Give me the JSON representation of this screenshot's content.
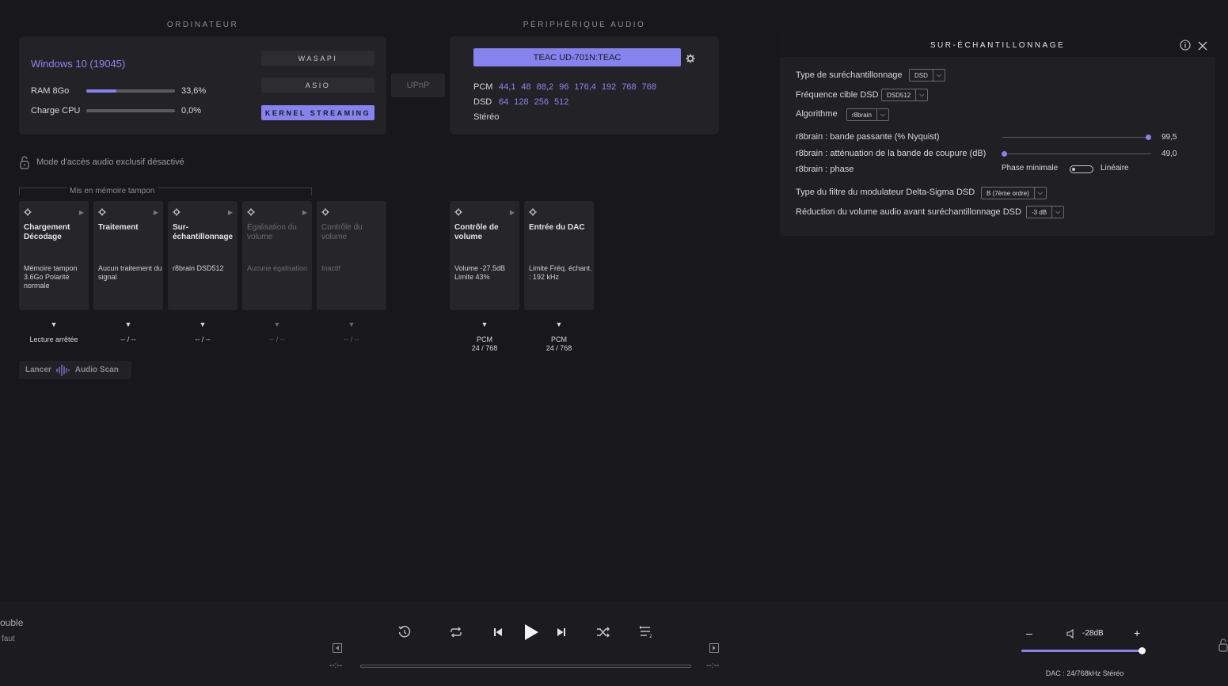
{
  "computer": {
    "heading": "ORDINATEUR",
    "os": "Windows 10 (19045)",
    "ram_label": "RAM 8Go",
    "ram_value": "33,6%",
    "ram_fraction": 0.336,
    "cpu_label": "Charge CPU",
    "cpu_value": "0,0%",
    "cpu_fraction": 0.0,
    "modes": [
      "WASAPI",
      "ASIO",
      "KERNEL STREAMING"
    ],
    "upnp": "UPnP",
    "exclusive_mode": "Mode d'accès audio exclusif désactivé"
  },
  "device": {
    "heading": "PÉRIPHÉRIQUE AUDIO",
    "name": "TEAC UD-701N:TEAC",
    "pcm_label": "PCM",
    "pcm_rates": [
      "44,1",
      "48",
      "88,2",
      "96",
      "176,4",
      "192",
      "768",
      "768"
    ],
    "dsd_label": "DSD",
    "dsd_rates": [
      "64",
      "128",
      "256",
      "512"
    ],
    "channels": "Stéréo"
  },
  "pipeline": {
    "buffer_label": "Mis en mémoire tampon",
    "cards": [
      {
        "title": "Chargement Décodage",
        "body": "Mémoire tampon 3.6Go Polarité normale",
        "status": "Lecture arrêtée"
      },
      {
        "title": "Traitement",
        "body": "Aucun traitement du signal",
        "status": "-- / --"
      },
      {
        "title": "Sur-échantillonnage",
        "body": "r8brain DSD512",
        "status": "-- / --"
      },
      {
        "title": "Égalisation du volume",
        "body": "Aucune égalisation",
        "status": "-- / --"
      },
      {
        "title": "Contrôle du volume",
        "body": "Inactif",
        "status": "-- / --"
      },
      {
        "title": "Contrôle de volume",
        "body": "Volume -27.5dB Limite 43%",
        "status_top": "PCM",
        "status_bottom": "24 / 768"
      },
      {
        "title": "Entrée du DAC",
        "body": "Limite Fréq. échant. : 192 kHz",
        "status_top": "PCM",
        "status_bottom": "24 / 768"
      }
    ],
    "scan_launch": "Lancer",
    "scan_label": "Audio Scan"
  },
  "resampling": {
    "title": "SUR-ÉCHANTILLONNAGE",
    "type_label": "Type de suréchantillonnage",
    "type_value": "DSD",
    "target_label": "Fréquence cible DSD",
    "target_value": "DSD512",
    "algo_label": "Algorithme",
    "algo_value": "r8brain",
    "bandwidth_label": "r8brain : bande passante (% Nyquist)",
    "bandwidth_value": "99,5",
    "attenuation_label": "r8brain : atténuation de la bande de coupure (dB)",
    "attenuation_value": "49,0",
    "phase_label": "r8brain : phase",
    "phase_min": "Phase minimale",
    "phase_lin": "Linéaire",
    "filter_label": "Type du filtre du modulateur Delta-Sigma DSD",
    "filter_value": "B (7ème ordre)",
    "reduction_label": "Réduction du volume audio avant suréchantillonnage DSD",
    "reduction_value": "-3 dB"
  },
  "player": {
    "left_line1": "ouble",
    "left_line2": "faut",
    "time_elapsed": "--:--",
    "time_remaining": "--:--",
    "volume_value": "-28dB",
    "volume_fraction": 0.97,
    "dac_status": "DAC : 24/768kHz Stéréo"
  }
}
